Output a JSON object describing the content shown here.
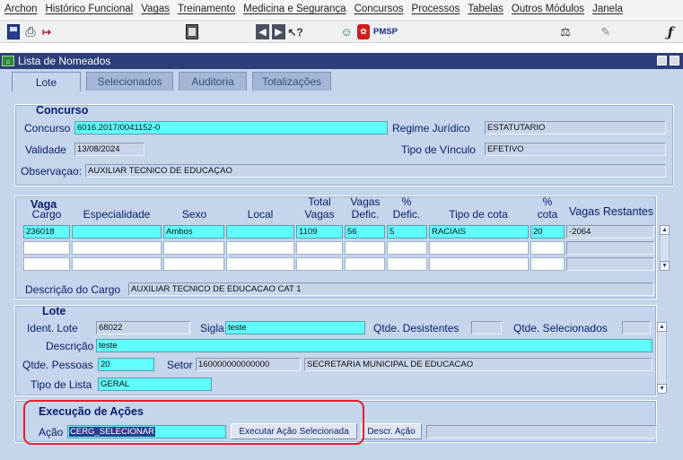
{
  "menubar": [
    "Archon",
    "Histórico Funcional",
    "Vagas",
    "Treinamento",
    "Medicina e Segurança",
    "Concursos",
    "Processos",
    "Tabelas",
    "Outros Módulos",
    "Janela"
  ],
  "toolbar": {
    "pmsp_label": "PMSP"
  },
  "icons": {
    "save": "save-icon",
    "print": "printer-icon",
    "exit": "exit-icon",
    "calc": "calculator-icon",
    "prev": "arrow-left-icon",
    "next": "arrow-right-icon",
    "help": "help-cursor-icon",
    "users": "users-icon",
    "pmsp": "pmsp-icon",
    "scale": "scale-icon",
    "tool": "tool-icon",
    "func": "function-icon"
  },
  "window": {
    "title": "Lista de Nomeados"
  },
  "tabs": [
    "Lote",
    "Selecionados",
    "Auditoria",
    "Totalizações"
  ],
  "concurso": {
    "section_title": "Concurso",
    "concurso_label": "Concurso",
    "concurso_value": "6016.2017/0041152-0",
    "regime_label": "Regime Jurídico",
    "regime_value": "ESTATUTARIO",
    "validade_label": "Validade",
    "validade_value": "13/08/2024",
    "vinculo_label": "Tipo de Vínculo",
    "vinculo_value": "EFETIVO",
    "observacao_label": "Observaçao:",
    "observacao_value": "AUXILIAR TECNICO DE EDUCAÇAO"
  },
  "vaga": {
    "section_title": "Vaga",
    "headers": {
      "cargo": "Cargo",
      "especialidade": "Especialidade",
      "sexo": "Sexo",
      "local": "Local",
      "total_vagas": [
        "Total",
        "Vagas"
      ],
      "vagas_defic": [
        "Vagas",
        "Defic."
      ],
      "pct_defic": [
        "%",
        "Defic."
      ],
      "tipo_cota": "Tipo de cota",
      "pct_cota": [
        "%",
        "cota"
      ],
      "restantes": "Vagas Restantes"
    },
    "rows": [
      {
        "cargo": "236018",
        "especialidade": "",
        "sexo": "Ambos",
        "local": "",
        "total": "1109",
        "defic": "56",
        "pct_defic": "5",
        "tipo_cota": "RACIAIS",
        "pct_cota": "20",
        "restantes": "-2064"
      }
    ],
    "descricao_label": "Descrição do Cargo",
    "descricao_value": "AUXILIAR TECNICO DE EDUCACAO CAT 1"
  },
  "lote": {
    "section_title": "Lote",
    "ident_label": "Ident. Lote",
    "ident_value": "68022",
    "sigla_label": "Sigla",
    "sigla_value": "teste",
    "desistentes_label": "Qtde. Desistentes",
    "desistentes_value": "",
    "selecionados_label": "Qtde. Selecionados",
    "selecionados_value": "",
    "descricao_label": "Descrição",
    "descricao_value": "teste",
    "pessoas_label": "Qtde. Pessoas",
    "pessoas_value": "20",
    "setor_label": "Setor",
    "setor_value": "160000000000000",
    "setor_desc": "SECRETARIA MUNICIPAL DE EDUCACAO",
    "tipo_lista_label": "Tipo de Lista",
    "tipo_lista_value": "GERAL"
  },
  "execucao": {
    "section_title": "Execução de Ações",
    "acao_label": "Ação",
    "acao_value": "CERG_SELECIONAR",
    "executar_button": "Executar Ação Selecionada",
    "descr_button": "Descr. Ação",
    "descr_value": ""
  },
  "colors": {
    "accent": "#5fffff",
    "frame": "#c4d5ec",
    "titlebar": "#2d3f7a",
    "highlight_border": "#e4202b"
  }
}
